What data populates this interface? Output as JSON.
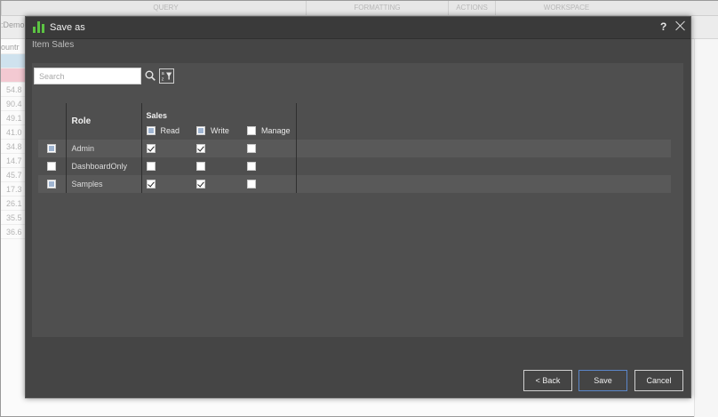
{
  "background": {
    "menu_items": [
      "QUERY",
      "FORMATTING",
      "ACTIONS",
      "WORKSPACE"
    ],
    "left_title": ":Demo",
    "list_header": "ountr",
    "list_values": [
      "54.8",
      "90.4",
      "49.1",
      "41.0",
      "34.8",
      "14.7",
      "45.7",
      "17.3",
      "26.1",
      "35.5",
      "36.6"
    ]
  },
  "dialog": {
    "title": "Save as",
    "help_label": "?",
    "subtitle": "Item Sales",
    "search": {
      "placeholder": "Search",
      "value": ""
    },
    "table": {
      "role_header": "Role",
      "group_header": "Sales",
      "permissions": [
        "Read",
        "Write",
        "Manage"
      ],
      "header_checkbox_states": [
        "partial",
        "partial",
        "unchecked"
      ],
      "rows": [
        {
          "select": "partial",
          "role": "Admin",
          "read": true,
          "write": true,
          "manage": false
        },
        {
          "select": "unchecked",
          "role": "DashboardOnly",
          "read": false,
          "write": false,
          "manage": false
        },
        {
          "select": "partial",
          "role": "Samples",
          "read": true,
          "write": true,
          "manage": false
        }
      ]
    },
    "buttons": {
      "back": "< Back",
      "save": "Save",
      "cancel": "Cancel"
    }
  },
  "colors": {
    "logo_green": "#5cc443",
    "dialog_bg": "#454545",
    "panel_bg": "#4f4f4f",
    "primary_border": "#5b86c8"
  },
  "icons": [
    "chart-logo-icon",
    "help-icon",
    "close-icon",
    "search-icon",
    "sort-filter-icon",
    "checkbox-icon"
  ]
}
